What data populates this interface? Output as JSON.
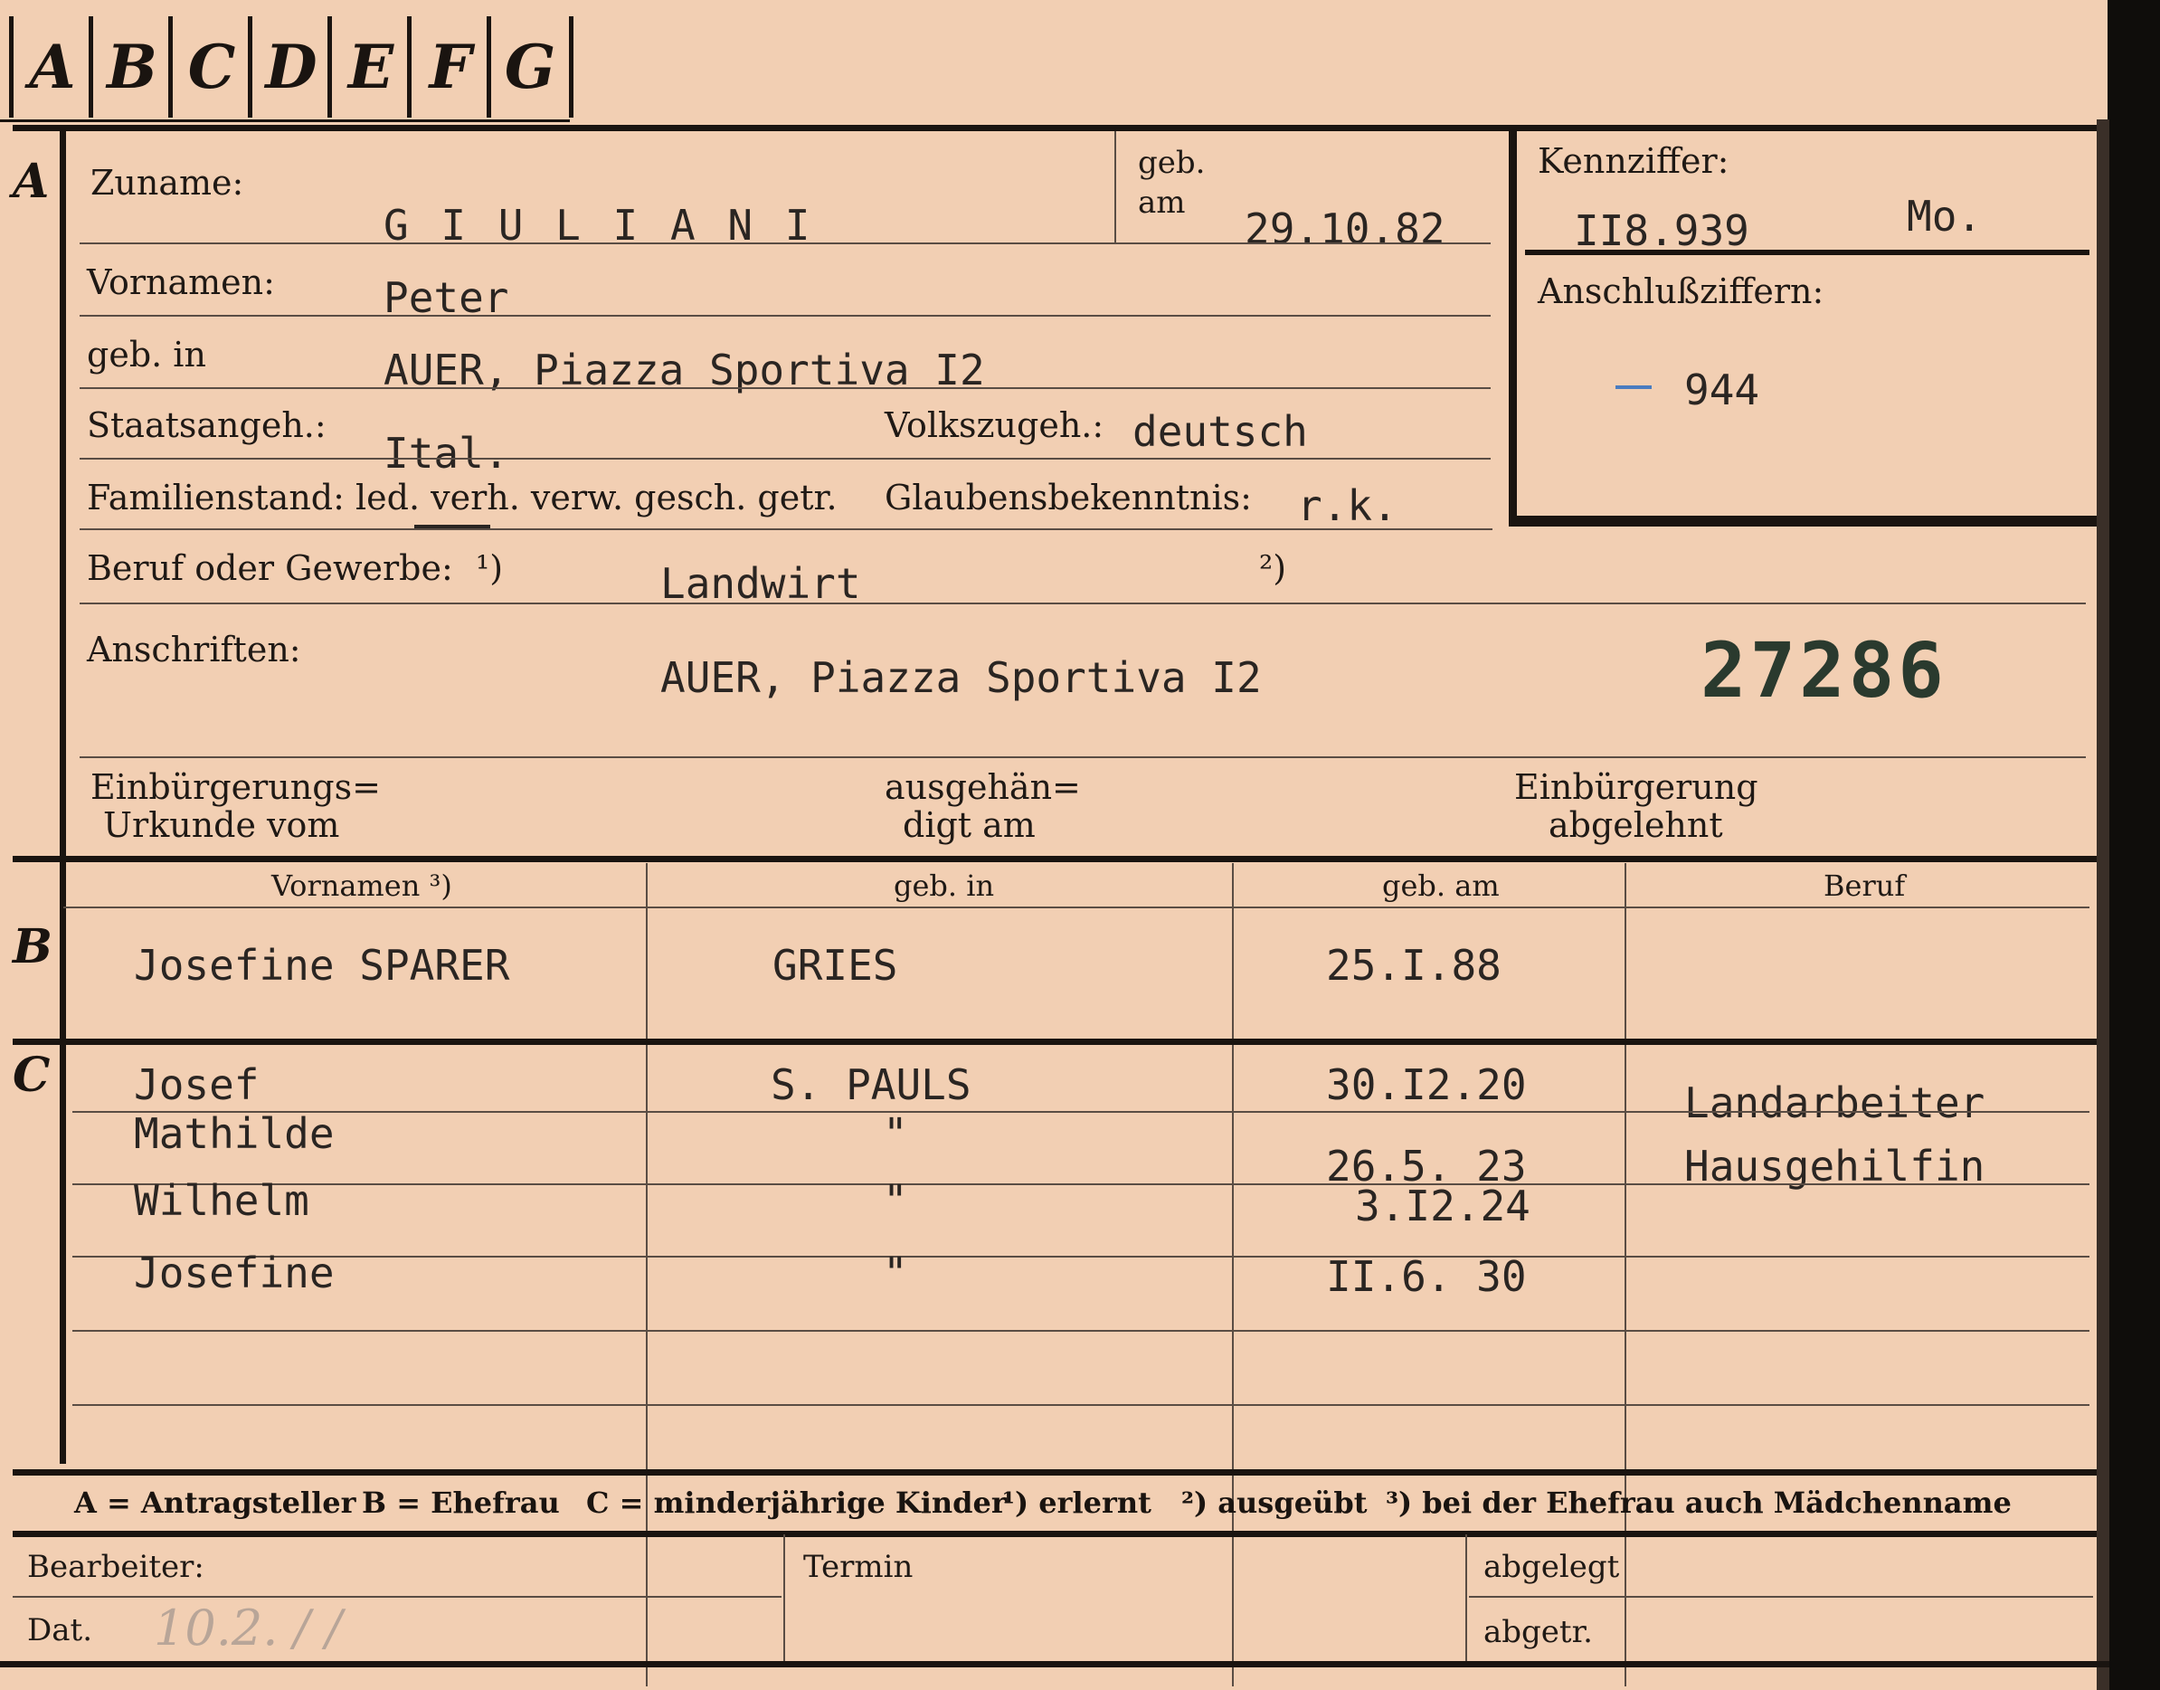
{
  "tabs": [
    "A",
    "B",
    "C",
    "D",
    "E",
    "F",
    "G"
  ],
  "section_a": {
    "letter": "A",
    "surname_label": "Zuname:",
    "surname": "G I U L I A N I",
    "birthdate_label_1": "geb.",
    "birthdate_label_2": "am",
    "birthdate": "29.10.82",
    "firstnames_label": "Vornamen:",
    "firstnames": "Peter",
    "birthplace_label": "geb. in",
    "birthplace": "AUER, Piazza Sportiva I2",
    "citizenship_label": "Staatsangeh.:",
    "citizenship": "Ital.",
    "ethnicity_label": "Volkszugeh.:",
    "ethnicity": "deutsch",
    "family_status_label": "Familienstand: led. verh. verw. gesch. getr.",
    "religion_label": "Glaubensbekenntnis:",
    "religion": "r.k.",
    "profession_label": "Beruf oder Gewerbe:",
    "profession_note_1": "¹)",
    "profession": "Landwirt",
    "profession_note_2": "²)",
    "address_label": "Anschriften:",
    "address": "AUER, Piazza Sportiva I2",
    "stamp_number": "27286",
    "naturalization_doc_label_1": "Einbürgerungs=",
    "naturalization_doc_label_2": "Urkunde vom",
    "handed_label_1": "ausgehän=",
    "handed_label_2": "digt am",
    "rejected_label_1": "Einbürgerung",
    "rejected_label_2": "abgelehnt",
    "id_number_label": "Kennziffer:",
    "id_number": "II8.939",
    "id_suffix": "Mo.",
    "link_numbers_label": "Anschlußziffern:",
    "link_number": "944"
  },
  "section_b": {
    "letter": "B",
    "headers": [
      "Vornamen ³)",
      "geb. in",
      "geb. am",
      "Beruf"
    ],
    "row": [
      "Josefine SPARER",
      "GRIES",
      "25.I.88",
      ""
    ]
  },
  "section_c": {
    "letter": "C",
    "children": [
      {
        "name": "Josef",
        "place": "S. PAULS",
        "date": "30.I2.20",
        "job": "Landarbeiter"
      },
      {
        "name": "Mathilde",
        "place": "\"",
        "date": "26.5. 23",
        "job": "Hausgehilfin"
      },
      {
        "name": "Wilhelm",
        "place": "\"",
        "date": "3.I2.24",
        "job": ""
      },
      {
        "name": "Josefine",
        "place": "\"",
        "date": "II.6. 30",
        "job": ""
      }
    ]
  },
  "legend": {
    "a": "A = Antragsteller",
    "b": "B = Ehefrau",
    "c": "C = minderjährige Kinder",
    "n1": "¹) erlernt",
    "n2": "²) ausgeübt",
    "n3": "³) bei der Ehefrau auch Mädchenname"
  },
  "footer": {
    "clerk_label": "Bearbeiter:",
    "date_label": "Dat.",
    "date_value": "10.2. /  /",
    "appointment_label": "Termin",
    "filed_label": "abgelegt",
    "filed2_label": "abgetr."
  }
}
